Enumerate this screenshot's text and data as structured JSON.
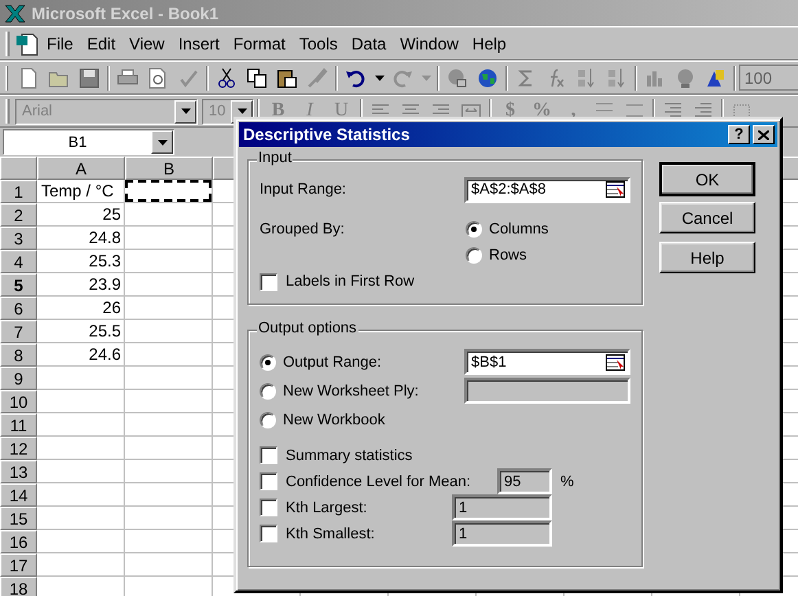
{
  "app_window": {
    "title": "Microsoft Excel - Book1"
  },
  "menu_bar": {
    "items": [
      "File",
      "Edit",
      "View",
      "Insert",
      "Format",
      "Tools",
      "Data",
      "Window",
      "Help"
    ]
  },
  "standard_toolbar": {
    "zoom": "100"
  },
  "formatting_toolbar": {
    "font": "Arial",
    "size": "10",
    "style_buttons": [
      "B",
      "I",
      "U"
    ],
    "number_buttons": [
      "$",
      "%",
      ","
    ]
  },
  "name_box": "B1",
  "sheet": {
    "columns": [
      "A",
      "B"
    ],
    "rows": [
      {
        "label": "1",
        "active": false,
        "marquee": true,
        "a": {
          "value": "Temp / °C",
          "kind": "text"
        }
      },
      {
        "label": "2",
        "active": false,
        "marquee": false,
        "a": {
          "value": "25",
          "kind": "number"
        }
      },
      {
        "label": "3",
        "active": false,
        "marquee": false,
        "a": {
          "value": "24.8",
          "kind": "number"
        }
      },
      {
        "label": "4",
        "active": false,
        "marquee": false,
        "a": {
          "value": "25.3",
          "kind": "number"
        }
      },
      {
        "label": "5",
        "active": true,
        "marquee": false,
        "a": {
          "value": "23.9",
          "kind": "number"
        }
      },
      {
        "label": "6",
        "active": false,
        "marquee": false,
        "a": {
          "value": "26",
          "kind": "number"
        }
      },
      {
        "label": "7",
        "active": false,
        "marquee": false,
        "a": {
          "value": "25.5",
          "kind": "number"
        }
      },
      {
        "label": "8",
        "active": false,
        "marquee": false,
        "a": {
          "value": "24.6",
          "kind": "number"
        }
      },
      {
        "label": "9",
        "active": false,
        "marquee": false
      },
      {
        "label": "10",
        "active": false,
        "marquee": false
      },
      {
        "label": "11",
        "active": false,
        "marquee": false
      },
      {
        "label": "12",
        "active": false,
        "marquee": false
      },
      {
        "label": "13",
        "active": false,
        "marquee": false
      },
      {
        "label": "14",
        "active": false,
        "marquee": false
      },
      {
        "label": "15",
        "active": false,
        "marquee": false
      },
      {
        "label": "16",
        "active": false,
        "marquee": false
      },
      {
        "label": "17",
        "active": false,
        "marquee": false
      },
      {
        "label": "18",
        "active": false,
        "marquee": false
      }
    ]
  },
  "dialog": {
    "title": "Descriptive Statistics",
    "help_glyph": "?",
    "input_group": {
      "label": "Input",
      "range_label": "Input Range:",
      "range": "$A$2:$A$8",
      "grouped_by_label": "Grouped By:",
      "grouped_by": [
        {
          "label": "Columns",
          "selected": true
        },
        {
          "label": "Rows",
          "selected": false
        }
      ],
      "labels_first_row": {
        "label": "Labels in First Row",
        "checked": false
      }
    },
    "buttons": [
      {
        "label": "OK",
        "default": true
      },
      {
        "label": "Cancel",
        "default": false
      },
      {
        "label": "Help",
        "default": false
      }
    ],
    "output_group": {
      "label": "Output options",
      "destinations": [
        {
          "label": "Output Range:",
          "selected": true,
          "kind": "ref",
          "value": "$B$1"
        },
        {
          "label": "New Worksheet Ply:",
          "selected": false,
          "kind": "plain"
        },
        {
          "label": "New Workbook",
          "selected": false,
          "kind": "none"
        }
      ],
      "options": [
        {
          "label": "Summary statistics",
          "checked": false
        },
        {
          "label": "Confidence Level for Mean:",
          "checked": false,
          "value": "95",
          "unit": "%"
        },
        {
          "label": "Kth Largest:",
          "checked": false,
          "value": "1"
        },
        {
          "label": "Kth Smallest:",
          "checked": false,
          "value": "1"
        }
      ]
    }
  }
}
